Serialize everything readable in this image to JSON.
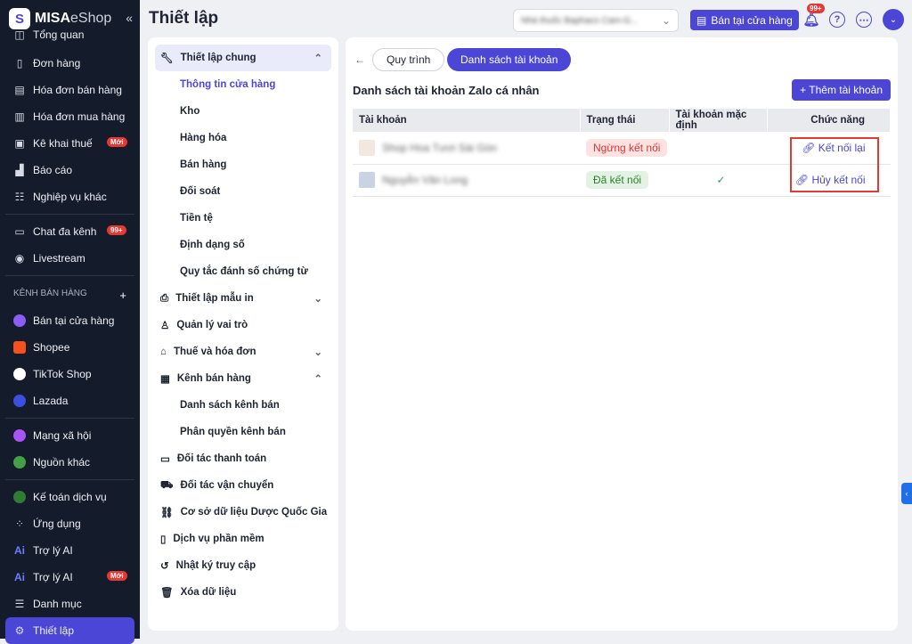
{
  "brand": {
    "name": "MISA",
    "suffix": "eShop"
  },
  "sidebar": {
    "items": [
      {
        "label": "Tổng quan",
        "icon": "dashboard-icon"
      },
      {
        "label": "Đơn hàng",
        "icon": "order-icon"
      },
      {
        "label": "Hóa đơn bán hàng",
        "icon": "invoice-icon"
      },
      {
        "label": "Hóa đơn mua hàng",
        "icon": "receipt-icon"
      },
      {
        "label": "Kê khai thuế",
        "icon": "tax-icon",
        "badge": "Mới"
      },
      {
        "label": "Báo cáo",
        "icon": "chart-icon"
      },
      {
        "label": "Nghiệp vụ khác",
        "icon": "list-icon"
      },
      {
        "label": "Chat đa kênh",
        "icon": "chat-icon",
        "badge": "99+"
      },
      {
        "label": "Livestream",
        "icon": "livestream-icon"
      }
    ],
    "section_label": "KÊNH BÁN HÀNG",
    "channels": [
      {
        "label": "Bán tại cửa hàng",
        "color": "#8b5cf6"
      },
      {
        "label": "Shopee",
        "color": "#f4511e"
      },
      {
        "label": "TikTok Shop",
        "color": "#ffffff"
      },
      {
        "label": "Lazada",
        "color": "#3b4fe0"
      }
    ],
    "others": [
      {
        "label": "Mạng xã hội",
        "color": "#a855f7"
      },
      {
        "label": "Nguồn khác",
        "color": "#43a047"
      }
    ],
    "bottom": [
      {
        "label": "Kế toán dịch vụ",
        "icon": "accounting-icon"
      },
      {
        "label": "Ứng dụng",
        "icon": "apps-icon"
      },
      {
        "label": "Trợ lý AI",
        "icon": "ai-icon"
      },
      {
        "label": "Trợ lý AI",
        "icon": "ai-icon",
        "badge": "Mới"
      },
      {
        "label": "Danh mục",
        "icon": "catalog-icon"
      },
      {
        "label": "Thiết lập",
        "icon": "gear-icon"
      }
    ]
  },
  "header": {
    "title": "Thiết lập",
    "store": "Nhà thuốc Baphaco Cam-G...",
    "sell_button": "Bán tại cửa hàng",
    "notif_badge": "99+"
  },
  "settings_menu": {
    "general": "Thiết lập chung",
    "general_sub": [
      "Thông tin cửa hàng",
      "Kho",
      "Hàng hóa",
      "Bán hàng",
      "Đối soát",
      "Tiền tệ",
      "Định dạng số",
      "Quy tắc đánh số chứng từ"
    ],
    "items_a": [
      "Thiết lập mẫu in",
      "Quản lý vai trò",
      "Thuế và hóa đơn"
    ],
    "channels": "Kênh bán hàng",
    "channels_sub": [
      "Danh sách kênh bán",
      "Phân quyền kênh bán"
    ],
    "items_b": [
      "Đối tác thanh toán",
      "Đối tác vận chuyển",
      "Cơ sở dữ liệu Dược Quốc Gia",
      "Dịch vụ phần mềm",
      "Nhật ký truy cập",
      "Xóa dữ liệu"
    ]
  },
  "main": {
    "tabs": [
      "Quy trình",
      "Danh sách tài khoản"
    ],
    "heading": "Danh sách tài khoản Zalo cá nhân",
    "add_button": "+ Thêm tài khoản",
    "columns": [
      "Tài khoản",
      "Trạng thái",
      "Tài khoản mặc định",
      "Chức năng"
    ],
    "rows": [
      {
        "account": "Shop Hoa Tươi Sài Gòn",
        "status": "Ngừng kết nối",
        "default": "",
        "action": "Kết nối lại"
      },
      {
        "account": "Nguyễn Văn Long",
        "status": "Đã kết nối",
        "default": "✓",
        "action": "Hủy kết nối"
      }
    ]
  }
}
